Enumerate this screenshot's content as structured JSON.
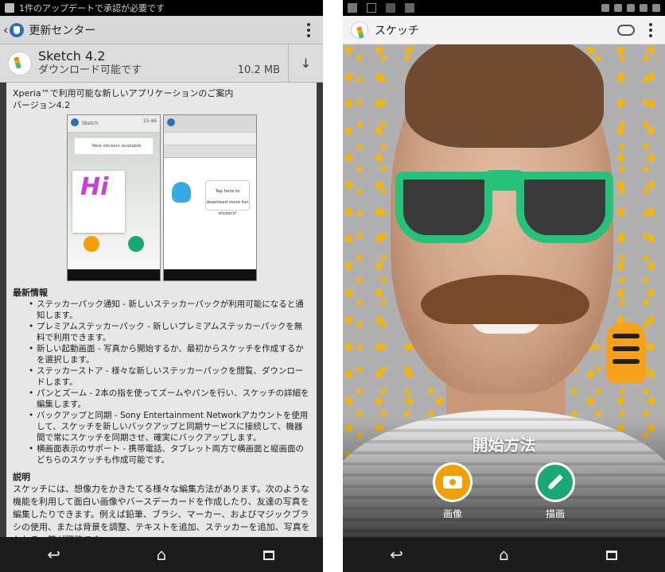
{
  "left": {
    "status_text": "1件のアップデートで承認が必要です",
    "actionbar": {
      "title": "更新センター"
    },
    "app": {
      "name": "Sketch 4.2",
      "status": "ダウンロード可能です",
      "size": "10.2 MB"
    },
    "description": {
      "intro_line1": "Xperia™で利用可能な新しいアプリケーションのご案内",
      "intro_line2": "バージョン4.2",
      "shot1_title": "Sketch",
      "shot1_time": "15:46",
      "shot1_notice": "New stickers available",
      "shot1_hi": "Hi",
      "shot2_tip": "Tap here to download more fun stickers!",
      "news_title": "最新情報",
      "news_items": [
        "ステッカーパック通知 - 新しいステッカーパックが利用可能になると通知します。",
        "プレミアムステッカーパック - 新しいプレミアムステッカーパックを無料で利用できます。",
        "新しい起動画面 - 写真から開始するか、最初からスケッチを作成するかを選択します。",
        "ステッカーストア - 様々な新しいステッカーパックを閲覧、ダウンロードします。",
        "パンとズーム - 2本の指を使ってズームやパンを行い、スケッチの詳細を編集します。",
        "バックアップと同期 - Sony Entertainment Networkアカウントを使用して、スケッチを新しいバックアップと同期サービスに接続して、機器間で常にスケッチを同期させ、確実にバックアップします。",
        "横画面表示のサポート - 携帯電話、タブレット両方で横画面と縦画面のどちらのスケッチも作成可能です。"
      ],
      "explain_title": "説明",
      "explain_text": "スケッチには、想像力をかきたてる様々な編集方法があります。次のような機能を利用して面白い画像やバースデーカードを作成したり、友達の写真を編集したりできます。例えば鉛筆、ブラシ、マーカー、およびマジックブラシの使用、または背景を調整、テキストを追加、ステッカーを追加、写真を入れる、等が可能です。"
    }
  },
  "right": {
    "actionbar": {
      "title": "スケッチ"
    },
    "start_title": "開始方法",
    "camera_label": "画像",
    "draw_label": "描画"
  },
  "colors": {
    "camera_orange": "#f0a100",
    "draw_green": "#1aa874",
    "glasses_green": "#27c27a"
  }
}
